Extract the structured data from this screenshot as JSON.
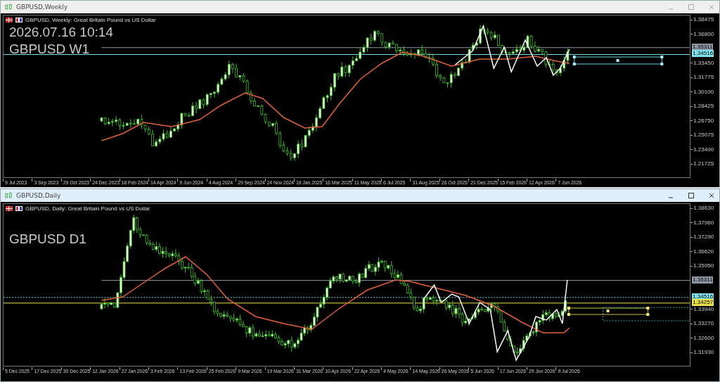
{
  "windows": [
    {
      "title": "GBPUSD,Weekly",
      "active": false,
      "header": "GBPUSD, Weekly:  Great Britain Pound vs US Dollar",
      "overlay_texts": [
        "2026.07.16 10:14",
        "GBPUSD W1"
      ],
      "price_ticks": [
        "1.38475",
        "1.36800",
        "1.33450",
        "1.31775",
        "1.30100",
        "1.28425",
        "1.26750",
        "1.25075",
        "1.23400",
        "1.21725"
      ],
      "price_tags": [
        {
          "text": "1.35311",
          "color": "#8c97a3",
          "kind": "short"
        },
        {
          "text": "1.34516",
          "color": "#7fe3ee",
          "kind": "full"
        }
      ],
      "date_labels": [
        "9 Jul 2023",
        "3 Sep 2023",
        "29 Oct 2023",
        "24 Dec 2023",
        "18 Feb 2024",
        "14 Apr 2024",
        "9 Jun 2024",
        "4 Aug 2024",
        "29 Sep 2024",
        "24 Nov 2024",
        "19 Jan 2025",
        "16 Mar 2025",
        "11 May 2025",
        "6 Jul 2025",
        "31 Aug 2025",
        "26 Oct 2025",
        "21 Dec 2025",
        "15 Feb 2026",
        "12 Apr 2026",
        "7 Jun 2026"
      ]
    },
    {
      "title": "GBPUSD,Daily",
      "active": true,
      "header": "GBPUSD, Daily:  Great Britain Pound vs US Dollar",
      "overlay_texts": [
        "GBPUSD D1"
      ],
      "price_ticks": [
        "1.38630",
        "1.37960",
        "1.37290",
        "1.36620",
        "1.35950",
        "1.33940",
        "1.33270",
        "1.32600",
        "1.31930"
      ],
      "price_tags": [
        {
          "text": "1.35311",
          "color": "#8c97a3",
          "kind": "short"
        },
        {
          "text": "1.34516",
          "color": "#7fe3ee",
          "kind": "dotted"
        },
        {
          "text": "1.34257",
          "color": "#e8e04a",
          "kind": "full"
        }
      ],
      "date_labels": [
        "5 Dec 2025",
        "17 Dec 2025",
        "30 Dec 2025",
        "12 Jan 2026",
        "22 Jan 2026",
        "3 Feb 2026",
        "13 Feb 2026",
        "25 Feb 2026",
        "9 Mar 2026",
        "19 Mar 2026",
        "31 Mar 2026",
        "10 Apr 2026",
        "22 Apr 2026",
        "4 May 2026",
        "14 May 2026",
        "26 May 2026",
        "5 Jun 2026",
        "17 Jun 2026",
        "29 Jun 2026",
        "9 Jul 2026"
      ]
    }
  ]
}
